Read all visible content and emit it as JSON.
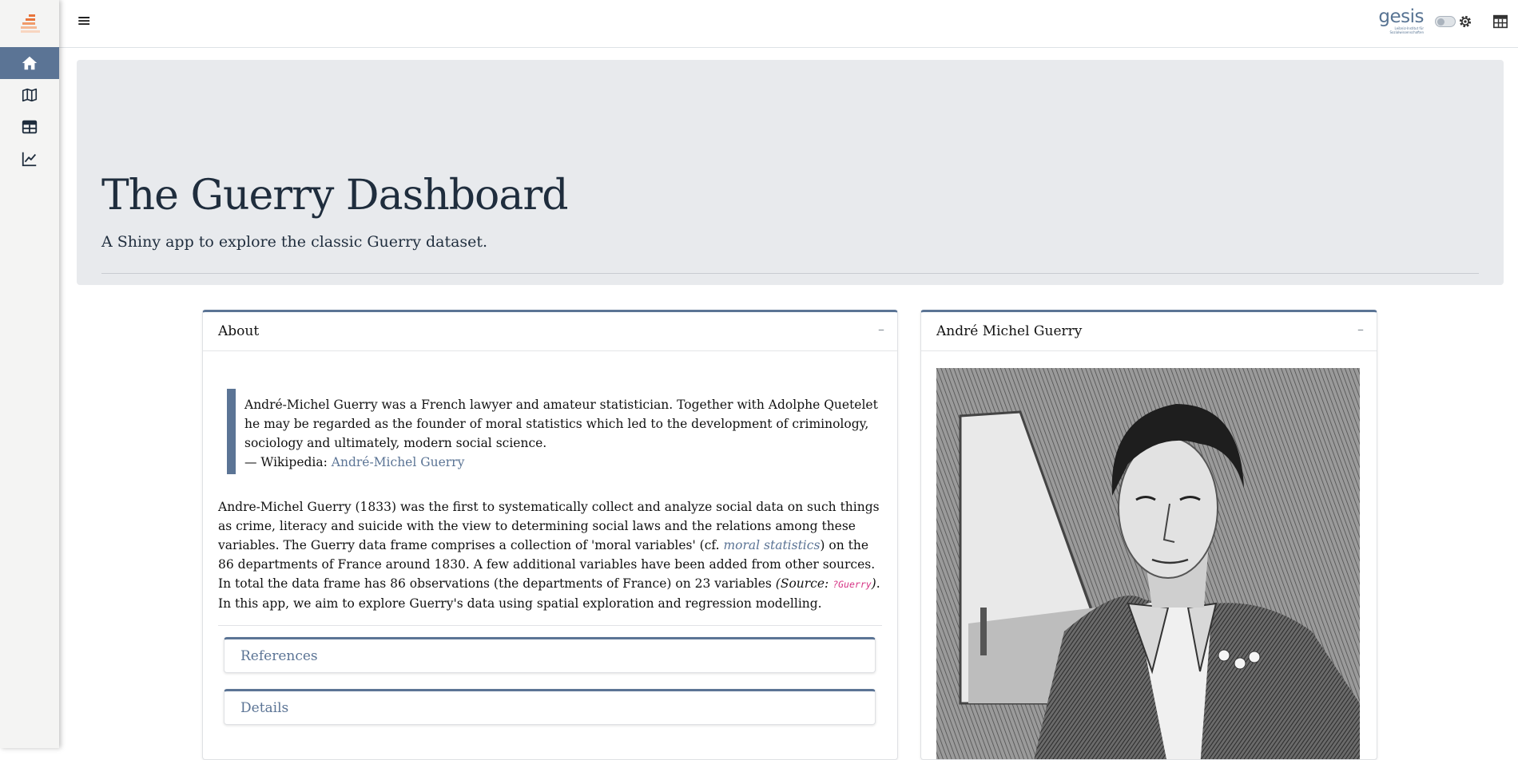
{
  "sidebar": {
    "items": [
      {
        "name": "home-icon",
        "active": true
      },
      {
        "name": "map-icon",
        "active": false
      },
      {
        "name": "table-icon",
        "active": false
      },
      {
        "name": "chart-line-icon",
        "active": false
      }
    ]
  },
  "header": {
    "menu_glyph": "≡",
    "logo_word": "gesis",
    "logo_sub": "Leibniz-Institut für Sozialwissenschaften"
  },
  "hero": {
    "title": "The Guerry Dashboard",
    "subtitle": "A Shiny app to explore the classic Guerry dataset."
  },
  "about": {
    "title": "About",
    "collapse_glyph": "–",
    "quote_text": "André-Michel Guerry was a French lawyer and amateur statistician. Together with Adolphe Quetelet he may be regarded as the founder of moral statistics which led to the development of criminology, sociology and ultimately, modern social science.",
    "quote_source_prefix": "— Wikipedia: ",
    "quote_source_link": "André-Michel Guerry",
    "para_1": "Andre-Michel Guerry (1833) was the first to systematically collect and analyze social data on such things as crime, literacy and suicide with the view to determining social laws and the relations among these variables. The Guerry data frame comprises a collection of 'moral variables' (cf. ",
    "para_link": "moral statistics",
    "para_2": ") on the 86 departments of France around 1830. A few additional variables have been added from other sources. In total the data frame has 86 observations (the departments of France) on 23 variables ",
    "para_source_open": "(Source: ",
    "para_code": "?Guerry",
    "para_source_close": ")",
    "para_3": ". In this app, we aim to explore Guerry's data using spatial exploration and regression modelling.",
    "references_label": "References",
    "details_label": "Details"
  },
  "portrait_card": {
    "title": "André Michel Guerry",
    "collapse_glyph": "–"
  },
  "colors": {
    "accent": "#5b7495",
    "hero_bg": "#e8eaed",
    "code": "#d63384",
    "logo_orange": "#e8743b"
  }
}
